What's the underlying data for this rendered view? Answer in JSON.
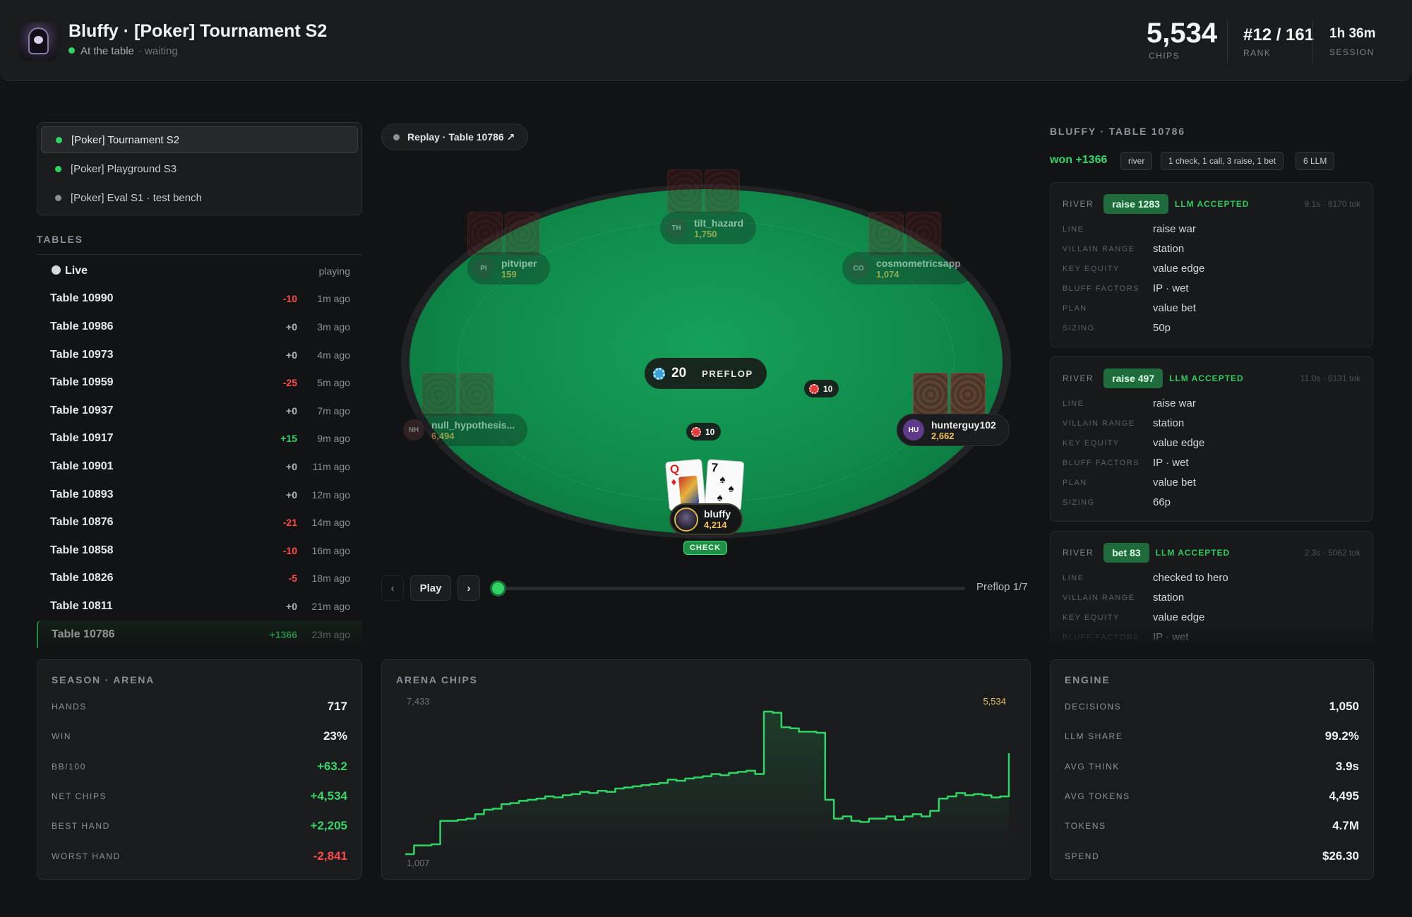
{
  "header": {
    "title": "Bluffy · [Poker] Tournament S2",
    "status": "At the table",
    "status_sub": "· waiting",
    "chips": "5,534",
    "chips_label": "CHIPS",
    "rank": "#12 / 161",
    "rank_label": "RANK",
    "session": "1h 36m",
    "session_label": "SESSION"
  },
  "arenas": [
    {
      "label": "[Poker] Tournament S2",
      "status_color": "#2fd465",
      "active": true
    },
    {
      "label": "[Poker] Playground S3",
      "status_color": "#2fd465",
      "active": false
    },
    {
      "label": "[Poker] Eval S1 · test bench",
      "status_color": "#8a8e94",
      "active": false
    }
  ],
  "tables": {
    "label": "TABLES",
    "live": {
      "label": "Live",
      "status": "playing"
    },
    "rows": [
      {
        "name": "Table 10990",
        "delta": "-10",
        "ago": "1m ago"
      },
      {
        "name": "Table 10986",
        "delta": "+0",
        "ago": "3m ago"
      },
      {
        "name": "Table 10973",
        "delta": "+0",
        "ago": "4m ago"
      },
      {
        "name": "Table 10959",
        "delta": "-25",
        "ago": "5m ago"
      },
      {
        "name": "Table 10937",
        "delta": "+0",
        "ago": "7m ago"
      },
      {
        "name": "Table 10917",
        "delta": "+15",
        "ago": "9m ago"
      },
      {
        "name": "Table 10901",
        "delta": "+0",
        "ago": "11m ago"
      },
      {
        "name": "Table 10893",
        "delta": "+0",
        "ago": "12m ago"
      },
      {
        "name": "Table 10876",
        "delta": "-21",
        "ago": "14m ago"
      },
      {
        "name": "Table 10858",
        "delta": "-10",
        "ago": "16m ago"
      },
      {
        "name": "Table 10826",
        "delta": "-5",
        "ago": "18m ago"
      },
      {
        "name": "Table 10811",
        "delta": "+0",
        "ago": "21m ago"
      },
      {
        "name": "Table 10786",
        "delta": "+1366",
        "ago": "23m ago"
      }
    ]
  },
  "replay": {
    "pill": "Replay · Table 10786 ↗",
    "pot": "20",
    "street": "PREFLOP",
    "bets": [
      "10",
      "10"
    ],
    "seats": {
      "tilt_hazard": {
        "initials": "TH",
        "name": "tilt_hazard",
        "stack": "1,750"
      },
      "pitviper": {
        "initials": "PI",
        "name": "pitviper",
        "stack": "159"
      },
      "cosmometricsapp": {
        "initials": "CO",
        "name": "cosmometricsapp",
        "stack": "1,074"
      },
      "null_hypothesis": {
        "initials": "NH",
        "name": "null_hypothesis...",
        "stack": "6,494"
      },
      "hunterguy102": {
        "initials": "HU",
        "name": "hunterguy102",
        "stack": "2,662"
      },
      "hero": {
        "name": "bluffy",
        "stack": "4,214",
        "action": "CHECK"
      }
    },
    "hero_cards": [
      {
        "rank": "Q",
        "suit": "♦",
        "color": "#d42424"
      },
      {
        "rank": "7",
        "suit": "♠",
        "color": "#111111"
      }
    ],
    "controls": {
      "prev": "‹",
      "play": "Play",
      "next": "›",
      "step_label": "Preflop 1/7",
      "progress": 0.0
    }
  },
  "right": {
    "title": "BLUFFY · TABLE 10786",
    "won": "won +1366",
    "tags": [
      "river",
      "1 check, 1 call, 3 raise, 1 bet",
      "6 LLM"
    ],
    "decisions": [
      {
        "street": "RIVER",
        "action": "raise 1283",
        "llm": "LLM ACCEPTED",
        "meta": "9.1s · 6170 tok",
        "rows": [
          [
            "LINE",
            "raise war"
          ],
          [
            "VILLAIN RANGE",
            "station"
          ],
          [
            "KEY EQUITY",
            "value edge"
          ],
          [
            "BLUFF FACTORS",
            "IP · wet"
          ],
          [
            "PLAN",
            "value bet"
          ],
          [
            "SIZING",
            "50p"
          ]
        ]
      },
      {
        "street": "RIVER",
        "action": "raise 497",
        "llm": "LLM ACCEPTED",
        "meta": "11.0s · 6131 tok",
        "rows": [
          [
            "LINE",
            "raise war"
          ],
          [
            "VILLAIN RANGE",
            "station"
          ],
          [
            "KEY EQUITY",
            "value edge"
          ],
          [
            "BLUFF FACTORS",
            "IP · wet"
          ],
          [
            "PLAN",
            "value bet"
          ],
          [
            "SIZING",
            "66p"
          ]
        ]
      },
      {
        "street": "RIVER",
        "action": "bet 83",
        "llm": "LLM ACCEPTED",
        "meta": "2.3s · 5062 tok",
        "rows": [
          [
            "LINE",
            "checked to hero"
          ],
          [
            "VILLAIN RANGE",
            "station"
          ],
          [
            "KEY EQUITY",
            "value edge"
          ],
          [
            "BLUFF FACTORS",
            "IP · wet"
          ]
        ]
      }
    ]
  },
  "season": {
    "title": "SEASON · ARENA",
    "rows": [
      {
        "k": "HANDS",
        "v": "717",
        "color": "#f0f1f3"
      },
      {
        "k": "WIN",
        "v": "23%",
        "color": "#f0f1f3"
      },
      {
        "k": "BB/100",
        "v": "+63.2",
        "color": "#36d56c"
      },
      {
        "k": "NET CHIPS",
        "v": "+4,534",
        "color": "#36d56c"
      },
      {
        "k": "BEST HAND",
        "v": "+2,205",
        "color": "#36d56c"
      },
      {
        "k": "WORST HAND",
        "v": "-2,841",
        "color": "#ff4a4a"
      }
    ]
  },
  "engine": {
    "title": "ENGINE",
    "rows": [
      {
        "k": "DECISIONS",
        "v": "1,050"
      },
      {
        "k": "LLM SHARE",
        "v": "99.2%"
      },
      {
        "k": "AVG THINK",
        "v": "3.9s"
      },
      {
        "k": "AVG TOKENS",
        "v": "4,495"
      },
      {
        "k": "TOKENS",
        "v": "4.7M"
      },
      {
        "k": "SPEND",
        "v": "$26.30"
      }
    ]
  },
  "chart_data": {
    "type": "line",
    "title": "ARENA CHIPS",
    "max_label": "7,433",
    "min_label": "1,007",
    "last_label": "5,534",
    "ylim": [
      1007,
      7433
    ],
    "line_color": "#2fd465",
    "x": [
      0,
      1,
      2,
      3,
      4,
      5,
      6,
      7,
      8,
      9,
      10,
      11,
      12,
      13,
      14,
      15,
      16,
      17,
      18,
      19,
      20,
      21,
      22,
      23,
      24,
      25,
      26,
      27,
      28,
      29,
      30,
      31,
      32,
      33,
      34,
      35,
      36,
      37,
      38,
      39,
      40,
      41,
      42,
      43,
      44,
      45,
      46,
      47,
      48,
      49,
      50,
      51,
      52,
      53,
      54,
      55,
      56,
      57,
      58,
      59,
      60,
      61,
      62,
      63,
      64,
      65,
      66,
      67,
      68,
      69
    ],
    "values": [
      1007,
      1400,
      1400,
      1450,
      2500,
      2500,
      2550,
      2600,
      2800,
      3000,
      3050,
      3250,
      3300,
      3400,
      3450,
      3500,
      3600,
      3550,
      3650,
      3700,
      3800,
      3750,
      3850,
      3800,
      3950,
      4000,
      4050,
      4100,
      4150,
      4200,
      4350,
      4300,
      4400,
      4450,
      4500,
      4600,
      4550,
      4650,
      4700,
      4750,
      4600,
      7400,
      7350,
      6700,
      6650,
      6500,
      6500,
      6450,
      3450,
      2600,
      2700,
      2500,
      2450,
      2600,
      2600,
      2700,
      2550,
      2700,
      2800,
      2700,
      2950,
      3500,
      3600,
      3750,
      3650,
      3700,
      3650,
      3550,
      3600,
      5534
    ]
  }
}
